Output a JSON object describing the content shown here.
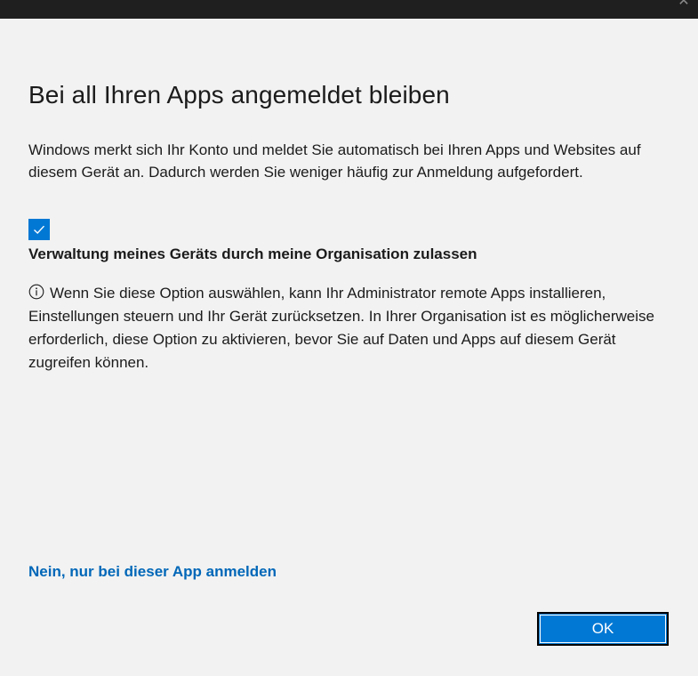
{
  "window": {
    "close_glyph": "✕"
  },
  "dialog": {
    "title": "Bei all Ihren Apps angemeldet bleiben",
    "description": "Windows merkt sich Ihr Konto und meldet Sie automatisch bei Ihren Apps und Websites auf diesem Gerät an. Dadurch werden Sie weniger häufig zur Anmeldung aufgefordert.",
    "checkbox": {
      "checked": true,
      "label": "Verwaltung meines Geräts durch meine Organisation zulassen"
    },
    "info_icon": "info-circle-icon",
    "info_text": "Wenn Sie diese Option auswählen, kann Ihr Administrator remote Apps installieren, Einstellungen steuern und Ihr Gerät zurücksetzen. In Ihrer Organisation ist es möglicherweise erforderlich, diese Option zu aktivieren, bevor Sie auf Daten und Apps auf diesem Gerät zugreifen können.",
    "link_label": "Nein, nur bei dieser App anmelden",
    "ok_label": "OK"
  },
  "colors": {
    "accent": "#0078d4",
    "link": "#0067b8",
    "background": "#f2f2f2",
    "titlebar": "#1f1f1f"
  }
}
